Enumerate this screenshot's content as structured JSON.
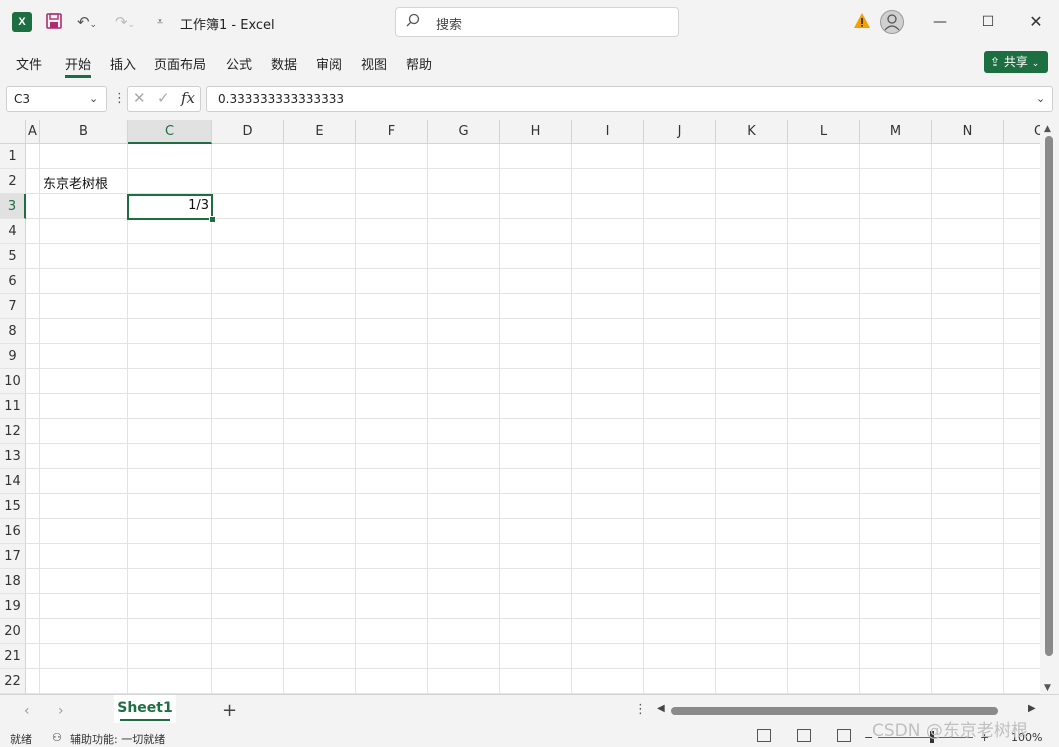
{
  "titlebar": {
    "app_icon": "X",
    "title": "工作簿1  -  Excel",
    "search_placeholder": "搜索",
    "icons": [
      "excel-icon",
      "save-icon",
      "undo-icon",
      "redo-icon",
      "customize-qat-icon",
      "search-icon",
      "warning-icon",
      "avatar",
      "minimize-icon",
      "maximize-icon",
      "close-icon"
    ]
  },
  "ribbon": {
    "tabs": [
      "文件",
      "开始",
      "插入",
      "页面布局",
      "公式",
      "数据",
      "审阅",
      "视图",
      "帮助"
    ],
    "active_tab": "开始",
    "share_label": "共享"
  },
  "formula_bar": {
    "name_box": "C3",
    "fx_label": "fx",
    "formula": "0.333333333333333"
  },
  "grid": {
    "columns": [
      "A",
      "B",
      "C",
      "D",
      "E",
      "F",
      "G",
      "H",
      "I",
      "J",
      "K",
      "L",
      "M",
      "N",
      "O"
    ],
    "rows": [
      "1",
      "2",
      "3",
      "4",
      "5",
      "6",
      "7",
      "8",
      "9",
      "10",
      "11",
      "12",
      "13",
      "14",
      "15",
      "16",
      "17",
      "18",
      "19",
      "20",
      "21",
      "22"
    ],
    "selected_column": "C",
    "selected_row": "3",
    "cells": {
      "B2": "东京老树根",
      "C3": "1/3"
    }
  },
  "sheets": {
    "tabs": [
      "Sheet1"
    ],
    "active": "Sheet1",
    "add_label": "+"
  },
  "status": {
    "ready": "就绪",
    "accessibility": "辅助功能: 一切就绪",
    "zoom": "100%"
  },
  "watermark": "CSDN @东京老树根",
  "colors": {
    "accent": "#1d6f42",
    "chrome": "#f3f3f3",
    "gridline": "#e3e3e3"
  }
}
